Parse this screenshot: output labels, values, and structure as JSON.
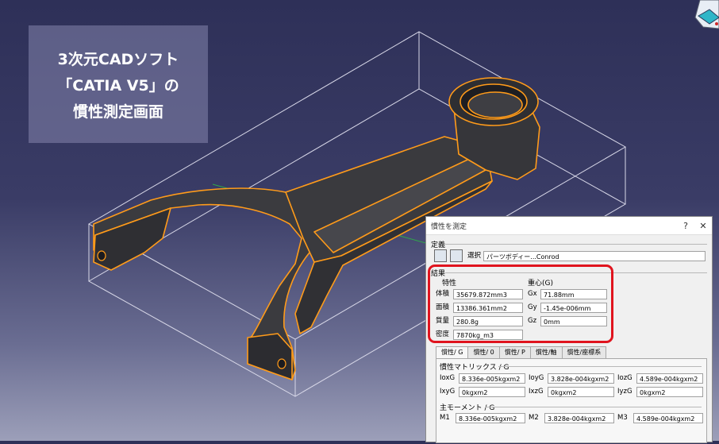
{
  "caption": {
    "line1": "3次元CADソフト",
    "line2": "「CATIA V5」の",
    "line3": "慣性測定画面"
  },
  "colors": {
    "part": "#3b3b3f",
    "edge": "#ff9b1a",
    "box": "#d8d8e8",
    "highlight": "#e0141e"
  },
  "dialog": {
    "title": "慣性を測定",
    "help": "?",
    "close": "✕",
    "definition": {
      "label": "定義",
      "select_label": "選択 :",
      "select_value": "パーツボディー...Conrod"
    },
    "results": {
      "label": "結果",
      "characteristics": {
        "label": "特性",
        "rows": [
          {
            "label": "体積",
            "value": "35679.872mm3"
          },
          {
            "label": "面積",
            "value": "13386.361mm2"
          },
          {
            "label": "質量",
            "value": "280.8g"
          },
          {
            "label": "密度",
            "value": "7870kg_m3"
          }
        ]
      },
      "center": {
        "label": "重心(G)",
        "rows": [
          {
            "label": "Gx",
            "value": "71.88mm"
          },
          {
            "label": "Gy",
            "value": "-1.45e-006mm"
          },
          {
            "label": "Gz",
            "value": "0mm"
          }
        ]
      }
    },
    "tabs": [
      "慣性/ G",
      "慣性/ 0",
      "慣性/ P",
      "慣性/軸",
      "慣性/座標系"
    ],
    "matrix": {
      "label": "慣性マトリックス / G",
      "rows": [
        [
          {
            "label": "IoxG",
            "value": "8.336e-005kgxm2"
          },
          {
            "label": "IoyG",
            "value": "3.828e-004kgxm2"
          },
          {
            "label": "IozG",
            "value": "4.589e-004kgxm2"
          }
        ],
        [
          {
            "label": "IxyG",
            "value": "0kgxm2"
          },
          {
            "label": "IxzG",
            "value": "0kgxm2"
          },
          {
            "label": "IyzG",
            "value": "0kgxm2"
          }
        ]
      ]
    },
    "principal": {
      "label": "主モーメント / G",
      "rows": [
        {
          "label": "M1",
          "value": "8.336e-005kgxm2"
        },
        {
          "label": "M2",
          "value": "3.828e-004kgxm2"
        },
        {
          "label": "M3",
          "value": "4.589e-004kgxm2"
        }
      ]
    }
  }
}
